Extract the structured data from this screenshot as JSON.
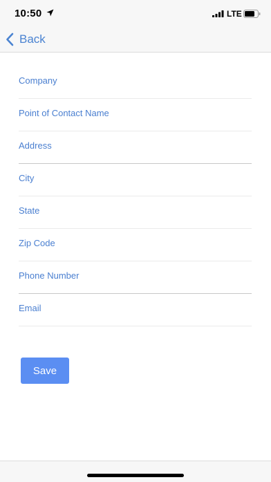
{
  "status_bar": {
    "time": "10:50",
    "network": "LTE",
    "location_icon": "location-arrow-icon",
    "signal_icon": "cellular-signal-icon",
    "battery_icon": "battery-icon"
  },
  "nav": {
    "back_label": "Back",
    "back_icon": "chevron-left-icon"
  },
  "form": {
    "fields": [
      {
        "placeholder": "Company",
        "value": ""
      },
      {
        "placeholder": "Point of Contact Name",
        "value": ""
      },
      {
        "placeholder": "Address",
        "value": ""
      },
      {
        "placeholder": "City",
        "value": ""
      },
      {
        "placeholder": "State",
        "value": ""
      },
      {
        "placeholder": "Zip Code",
        "value": ""
      },
      {
        "placeholder": "Phone Number",
        "value": ""
      },
      {
        "placeholder": "Email",
        "value": ""
      }
    ],
    "save_label": "Save"
  },
  "colors": {
    "accent": "#4a83d1",
    "placeholder": "#4a7fd0",
    "button": "#5b8ef2",
    "bar_background": "#f7f7f7"
  }
}
